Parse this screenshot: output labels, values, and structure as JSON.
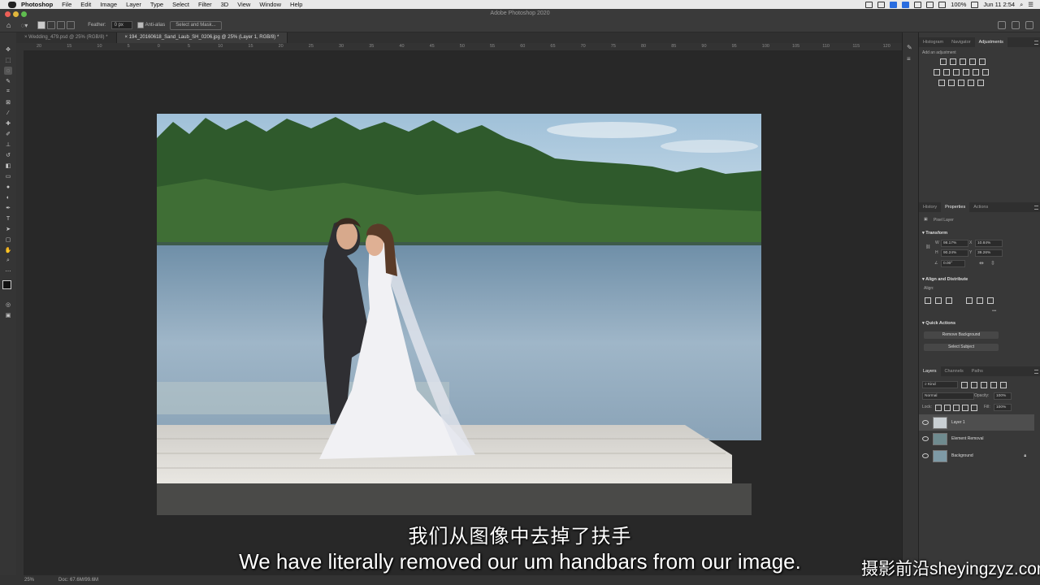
{
  "menubar": {
    "app": "Photoshop",
    "items": [
      "File",
      "Edit",
      "Image",
      "Layer",
      "Type",
      "Select",
      "Filter",
      "3D",
      "View",
      "Window",
      "Help"
    ],
    "battery": "100%",
    "clock": "Jun 11 2:54"
  },
  "window": {
    "title": "Adobe Photoshop 2020"
  },
  "options": {
    "feather_label": "Feather:",
    "feather_value": "0 px",
    "antialias_label": "Anti-alias",
    "select_mask_label": "Select and Mask..."
  },
  "tabs": [
    {
      "label": "Wedding_479.psd @ 25% (RGB/8) *"
    },
    {
      "label": "194_20160618_Sand_Laub_SH_0206.jpg @ 25% (Layer 1, RGB/8) *"
    }
  ],
  "ruler": {
    "ticks": [
      "20",
      "15",
      "10",
      "5",
      "0",
      "5",
      "10",
      "15",
      "20",
      "25",
      "30",
      "35",
      "40",
      "45",
      "50",
      "55",
      "60",
      "65",
      "70",
      "75",
      "80",
      "85",
      "90",
      "95",
      "100",
      "105",
      "110",
      "115",
      "120"
    ]
  },
  "panels": {
    "top_tabs": [
      "Histogram",
      "Navigator",
      "Adjustments"
    ],
    "adjust_hint": "Add an adjustment",
    "mid_tabs": [
      "History",
      "Properties",
      "Actions"
    ],
    "pixel_layer": "Pixel Layer",
    "transform_label": "Transform",
    "w_label": "W",
    "w_value": "98.17%",
    "h_label": "H",
    "h_value": "90.24%",
    "x_label": "X",
    "x_value": "10.84%",
    "y_label": "Y",
    "y_value": "39.26%",
    "angle_value": "0.00°",
    "align_label": "Align and Distribute",
    "align_sub": "Align:",
    "quick_actions": "Quick Actions",
    "remove_bg": "Remove Background",
    "select_subject": "Select Subject",
    "layer_tabs": [
      "Layers",
      "Channels",
      "Paths"
    ],
    "kind_label": "Kind",
    "blend_mode": "Normal",
    "opacity_label": "Opacity:",
    "opacity_value": "100%",
    "lock_label": "Lock:",
    "fill_label": "Fill:",
    "fill_value": "100%",
    "layers": [
      "Layer 1",
      "Element Removal",
      "Background"
    ]
  },
  "status": {
    "zoom": "25%",
    "doc": "Doc: 67.6M/99.6M"
  },
  "subtitles": {
    "chinese": "我们从图像中去掉了扶手",
    "english": "We have literally removed our um handbars from our image."
  },
  "watermark": "摄影前沿sheyingzyz.com",
  "colors": {
    "accent": "#2a6de0",
    "panel_bg": "#383838",
    "canvas_bg": "#282828"
  }
}
